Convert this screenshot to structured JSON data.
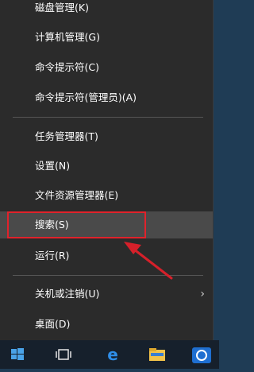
{
  "menu": {
    "items": [
      {
        "label": "磁盘管理(K)"
      },
      {
        "label": "计算机管理(G)"
      },
      {
        "label": "命令提示符(C)"
      },
      {
        "label": "命令提示符(管理员)(A)"
      },
      {
        "label": "任务管理器(T)"
      },
      {
        "label": "设置(N)"
      },
      {
        "label": "文件资源管理器(E)"
      },
      {
        "label": "搜索(S)"
      },
      {
        "label": "运行(R)"
      },
      {
        "label": "关机或注销(U)"
      },
      {
        "label": "桌面(D)"
      }
    ],
    "submenu_chevron": "›"
  },
  "taskbar": {
    "icons": [
      "windows-start-icon",
      "task-view-icon",
      "edge-icon",
      "file-explorer-icon",
      "store-icon"
    ]
  },
  "colors": {
    "menu_bg": "#2b2b2b",
    "hover_bg": "#4a4a4a",
    "highlight": "#e0222b"
  }
}
